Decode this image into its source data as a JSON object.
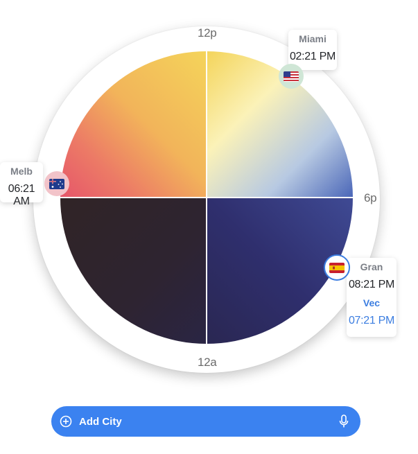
{
  "dial": {
    "hour_labels": {
      "top": "12p",
      "right": "6p",
      "bottom": "12a"
    }
  },
  "cities": [
    {
      "name": "Miami",
      "time": "02:21 PM",
      "flag_icon": "us-flag-icon"
    },
    {
      "name": "Melb",
      "time": "06:21 AM",
      "flag_icon": "australia-flag-icon"
    },
    {
      "name": "Gran",
      "time": "08:21 PM",
      "sub_name": "Vec",
      "sub_time": "07:21 PM",
      "flag_icon": "spain-flag-icon"
    }
  ],
  "add_city": {
    "label": "Add City",
    "icon": "plus-circle-icon",
    "mic_icon": "microphone-icon"
  },
  "colors": {
    "accent": "#3b82f0",
    "local_highlight": "#3b7de0",
    "morning_red": "#e85a6a",
    "noon_yellow": "#f4d75a",
    "dusk_blue": "#6f9bd6",
    "night_navy": "#2c2a5c",
    "midnight": "#2d2426"
  }
}
